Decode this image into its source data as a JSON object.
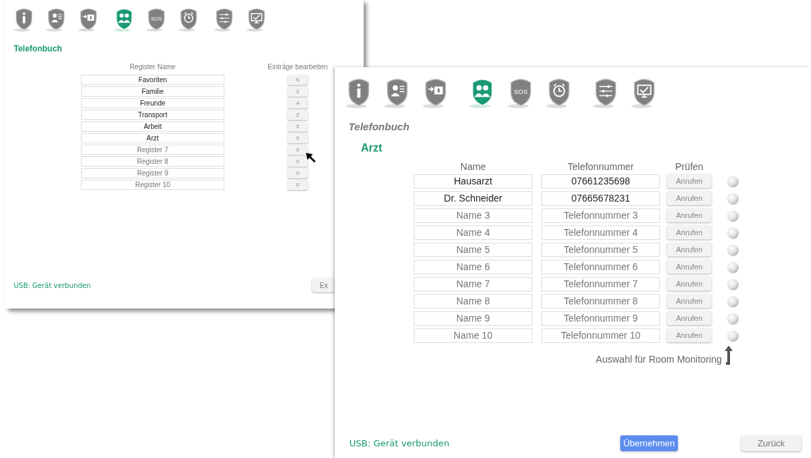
{
  "back_window": {
    "tab_groups": [
      [
        {
          "kind": "info",
          "selected": false
        },
        {
          "kind": "contacts",
          "selected": false
        },
        {
          "kind": "transfer",
          "selected": false
        }
      ],
      [
        {
          "kind": "people",
          "selected": true
        },
        {
          "kind": "sos",
          "label": "SOS",
          "selected": false
        },
        {
          "kind": "alarm",
          "selected": false
        }
      ],
      [
        {
          "kind": "sliders",
          "selected": false
        },
        {
          "kind": "monitor",
          "selected": false
        }
      ]
    ],
    "title": "Telefonbuch",
    "columns": [
      "Register Name",
      "Einträge bearbeiten"
    ],
    "registers": [
      {
        "name": {
          "value": "Favoriten"
        },
        "count": "6"
      },
      {
        "name": {
          "value": "Familie"
        },
        "count": "2"
      },
      {
        "name": {
          "value": "Freunde"
        },
        "count": "4"
      },
      {
        "name": {
          "value": "Transport"
        },
        "count": "2"
      },
      {
        "name": {
          "value": "Arbeit"
        },
        "count": "5"
      },
      {
        "name": {
          "value": "Arzt"
        },
        "count": "0"
      },
      {
        "name": {
          "placeholder": "Register 7"
        },
        "count": "0"
      },
      {
        "name": {
          "placeholder": "Register 8"
        },
        "count": "0"
      },
      {
        "name": {
          "placeholder": "Register 9"
        },
        "count": "0"
      },
      {
        "name": {
          "placeholder": "Register 10"
        },
        "count": "0"
      }
    ],
    "status": "USB: Gerät verbunden",
    "button": "Ex"
  },
  "front_window": {
    "tab_groups": [
      [
        {
          "kind": "info",
          "selected": false
        },
        {
          "kind": "contacts",
          "selected": false
        },
        {
          "kind": "transfer",
          "selected": false
        }
      ],
      [
        {
          "kind": "people",
          "selected": true
        },
        {
          "kind": "sos",
          "label": "SOS",
          "selected": false
        },
        {
          "kind": "alarm",
          "selected": false
        }
      ],
      [
        {
          "kind": "sliders",
          "selected": false
        },
        {
          "kind": "monitor",
          "selected": false
        }
      ]
    ],
    "title": "Telefonbuch",
    "register": "Arzt",
    "columns": [
      "Name",
      "Telefonnummer",
      "Prüfen"
    ],
    "contacts": [
      {
        "name": {
          "value": "Hausarzt"
        },
        "phone": {
          "value": "07661235698"
        },
        "call": "Anrufen",
        "selected": false
      },
      {
        "name": {
          "value": "Dr. Schneider"
        },
        "phone": {
          "value": "07665678231"
        },
        "call": "Anrufen",
        "selected": false
      },
      {
        "name": {
          "placeholder": "Name 3"
        },
        "phone": {
          "placeholder": "Telefonnummer 3"
        },
        "call": "Anrufen",
        "selected": false
      },
      {
        "name": {
          "placeholder": "Name 4"
        },
        "phone": {
          "placeholder": "Telefonnummer 4"
        },
        "call": "Anrufen",
        "selected": false
      },
      {
        "name": {
          "placeholder": "Name 5"
        },
        "phone": {
          "placeholder": "Telefonnummer 5"
        },
        "call": "Anrufen",
        "selected": false
      },
      {
        "name": {
          "placeholder": "Name 6"
        },
        "phone": {
          "placeholder": "Telefonnummer 6"
        },
        "call": "Anrufen",
        "selected": false
      },
      {
        "name": {
          "placeholder": "Name 7"
        },
        "phone": {
          "placeholder": "Telefonnummer 7"
        },
        "call": "Anrufen",
        "selected": false
      },
      {
        "name": {
          "placeholder": "Name 8"
        },
        "phone": {
          "placeholder": "Telefonnummer 8"
        },
        "call": "Anrufen",
        "selected": false
      },
      {
        "name": {
          "placeholder": "Name 9"
        },
        "phone": {
          "placeholder": "Telefonnummer 9"
        },
        "call": "Anrufen",
        "selected": false
      },
      {
        "name": {
          "placeholder": "Name 10"
        },
        "phone": {
          "placeholder": "Telefonnummer 10"
        },
        "call": "Anrufen",
        "selected": false
      }
    ],
    "hint": "Auswahl für Room Monitoring",
    "status": "USB: Gerät verbunden",
    "buttons": [
      {
        "label": "Übernehmen",
        "kind": "primary"
      },
      {
        "label": "Zurück",
        "kind": "secondary"
      }
    ]
  }
}
